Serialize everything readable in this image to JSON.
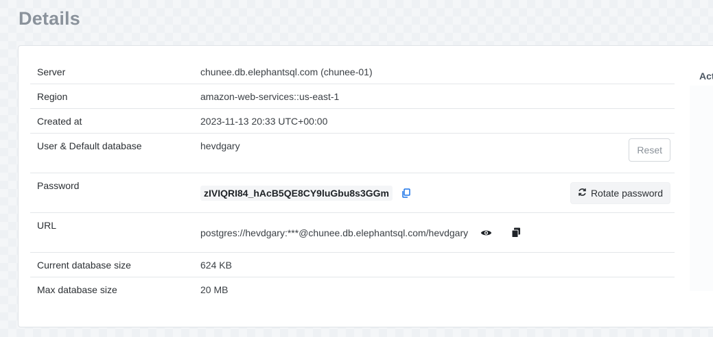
{
  "header": {
    "title": "Details"
  },
  "side": {
    "label": "Act"
  },
  "details": {
    "server": {
      "label": "Server",
      "value": "chunee.db.elephantsql.com (chunee-01)"
    },
    "region": {
      "label": "Region",
      "value": "amazon-web-services::us-east-1"
    },
    "created": {
      "label": "Created at",
      "value": "2023-11-13 20:33 UTC+00:00"
    },
    "user": {
      "label": "User & Default database",
      "value": "hevdgary",
      "button": "Reset"
    },
    "password": {
      "label": "Password",
      "value": "zIVIQRI84_hAcB5QE8CY9luGbu8s3GGm",
      "button": "Rotate password"
    },
    "url": {
      "label": "URL",
      "value": "postgres://hevdgary:***@chunee.db.elephantsql.com/hevdgary"
    },
    "current_size": {
      "label": "Current database size",
      "value": "624 KB"
    },
    "max_size": {
      "label": "Max database size",
      "value": "20 MB"
    }
  },
  "icons": {
    "copy_password": "copy-icon",
    "show_url": "eye-icon",
    "copy_url": "clipboard-icon",
    "rotate": "rotate-icon"
  },
  "colors": {
    "accent_link": "#1a73e8",
    "title": "#8a929b"
  }
}
